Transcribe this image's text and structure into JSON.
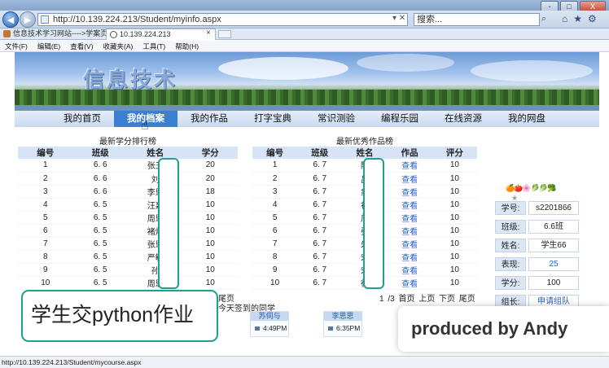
{
  "browser": {
    "address": "http://10.139.224.213/Student/myinfo.aspx",
    "search_placeholder": "搜索...",
    "tabs": [
      {
        "label": "信息技术学习网站---->学案页面"
      },
      {
        "label": "10.139.224.213"
      }
    ],
    "menu": [
      "文件(F)",
      "编辑(E)",
      "查看(V)",
      "收藏夹(A)",
      "工具(T)",
      "帮助(H)"
    ],
    "window_buttons": [
      "-",
      "□",
      "X"
    ],
    "status_url": "http://10.139.224.213/Student/mycourse.aspx"
  },
  "site": {
    "banner_title": "信息技术",
    "nav": [
      "我的首页",
      "我的档案",
      "我的作品",
      "打字宝典",
      "常识测验",
      "编程乐园",
      "在线资源",
      "我的网盘"
    ],
    "active_nav": 1
  },
  "scores": {
    "title": "最新学分排行榜",
    "headers": [
      "编号",
      "班级",
      "姓名",
      "学分"
    ],
    "rows": [
      [
        "1",
        "6. 6",
        "张王",
        "20"
      ],
      [
        "2",
        "6. 6",
        "刘",
        "20"
      ],
      [
        "3",
        "6. 6",
        "李思",
        "18"
      ],
      [
        "4",
        "6. 5",
        "汪嘉",
        "10"
      ],
      [
        "5",
        "6. 5",
        "周思",
        "10"
      ],
      [
        "6",
        "6. 5",
        "褚炉",
        "10"
      ],
      [
        "7",
        "6. 5",
        "张思",
        "10"
      ],
      [
        "8",
        "6. 5",
        "严敏",
        "10"
      ],
      [
        "9",
        "6. 5",
        "孙",
        "10"
      ],
      [
        "10",
        "6. 5",
        "周思",
        "10"
      ]
    ],
    "pager": "尾页"
  },
  "works": {
    "title": "最新优秀作品榜",
    "headers": [
      "编号",
      "班级",
      "姓名",
      "作品",
      "评分"
    ],
    "view_label": "查看",
    "rows": [
      [
        "1",
        "6. 7",
        "陆",
        "10"
      ],
      [
        "2",
        "6. 7",
        "吕",
        "10"
      ],
      [
        "3",
        "6. 7",
        "翁",
        "10"
      ],
      [
        "4",
        "6. 7",
        "祝",
        "10"
      ],
      [
        "5",
        "6. 7",
        "周",
        "10"
      ],
      [
        "6",
        "6. 7",
        "张",
        "10"
      ],
      [
        "7",
        "6. 7",
        "朱",
        "10"
      ],
      [
        "8",
        "6. 7",
        "宋",
        "10"
      ],
      [
        "9",
        "6. 7",
        "宋",
        "10"
      ],
      [
        "10",
        "6. 7",
        "徐",
        "10"
      ]
    ],
    "pager": "1 /3  首页 上页 下页 尾页"
  },
  "signin": {
    "title": "今天签到的同学",
    "students": [
      {
        "name": "苏伺与",
        "time": "4:49PM"
      },
      {
        "name": "李思思",
        "time": "6:35PM"
      }
    ]
  },
  "profile": {
    "fruits": "🍊🍅🌸🥬🥬🥦",
    "star": "★",
    "fields": [
      {
        "label": "学号:",
        "value": "s2201866"
      },
      {
        "label": "班级:",
        "value": "6.6班"
      },
      {
        "label": "姓名:",
        "value": "学生66"
      },
      {
        "label": "表现:",
        "value": "25"
      },
      {
        "label": "学分:",
        "value": "100"
      },
      {
        "label": "组长:",
        "value": "申请组队"
      }
    ]
  },
  "overlay": {
    "caption": "学生交python作业",
    "producer": "produced by Andy"
  }
}
